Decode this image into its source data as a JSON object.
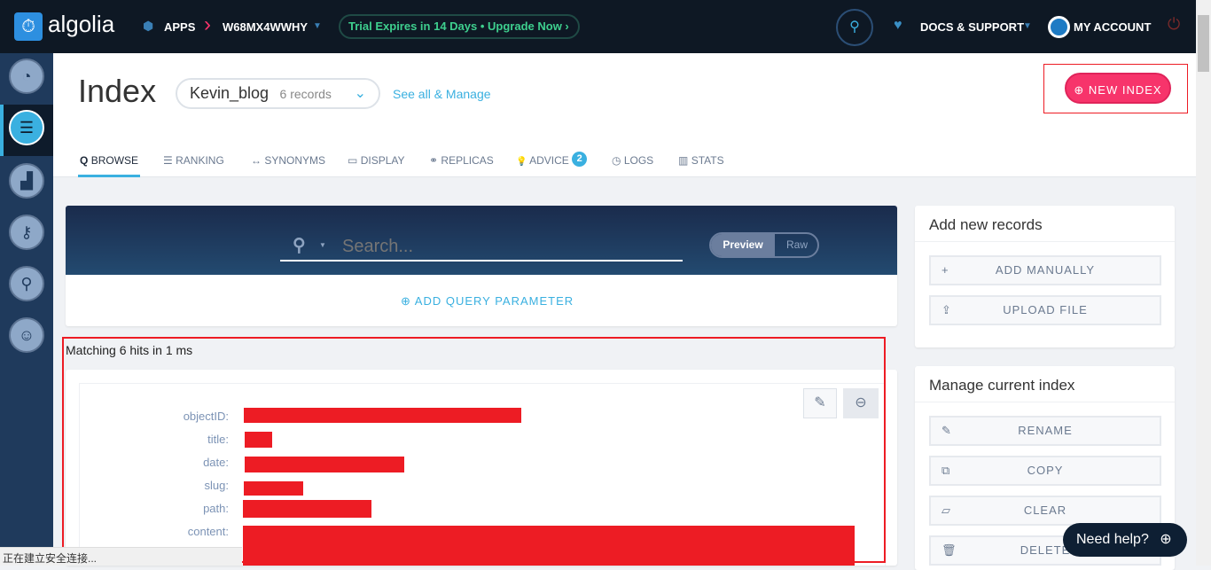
{
  "topbar": {
    "logo": "algolia",
    "apps": "APPS",
    "app_id": "W68MX4WWHY",
    "trial": "Trial Expires in 14 Days • Upgrade Now",
    "docs": "DOCS & SUPPORT",
    "account": "MY ACCOUNT"
  },
  "sidebar": {
    "items": [
      "dashboard-icon",
      "indices-icon",
      "analytics-icon",
      "api-keys-icon",
      "geo-icon",
      "team-icon"
    ],
    "active": 1
  },
  "header": {
    "title": "Index",
    "index_name": "Kevin_blog",
    "records": "6 records",
    "see_all": "See all & Manage",
    "new_index": "NEW INDEX",
    "tabs": [
      {
        "label": "BROWSE",
        "icon": "Q"
      },
      {
        "label": "RANKING",
        "icon": "☰"
      },
      {
        "label": "SYNONYMS",
        "icon": "↔"
      },
      {
        "label": "DISPLAY",
        "icon": "▭"
      },
      {
        "label": "REPLICAS",
        "icon": "⚭"
      },
      {
        "label": "ADVICE",
        "icon": "💡",
        "badge": "2"
      },
      {
        "label": "LOGS",
        "icon": "◷"
      },
      {
        "label": "STATS",
        "icon": "▥"
      }
    ]
  },
  "search": {
    "placeholder": "Search...",
    "preview": "Preview",
    "raw": "Raw",
    "add_param": "ADD QUERY PARAMETER"
  },
  "results": {
    "summary": "Matching 6 hits in 1 ms",
    "fields": [
      "objectID:",
      "title:",
      "date:",
      "slug:",
      "path:",
      "content:"
    ]
  },
  "add_records": {
    "title": "Add new records",
    "buttons": [
      "ADD MANUALLY",
      "UPLOAD FILE"
    ]
  },
  "manage": {
    "title": "Manage current index",
    "buttons": [
      "RENAME",
      "COPY",
      "CLEAR",
      "DELETE"
    ]
  },
  "help": "Need help?",
  "status": "正在建立安全连接...",
  "colors": {
    "accent": "#3ab0e0",
    "brand_pink": "#f7346b",
    "topbar": "#0e1824"
  }
}
